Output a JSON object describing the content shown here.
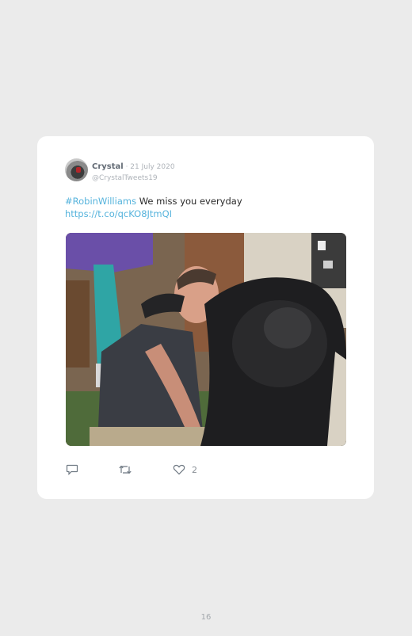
{
  "tweet": {
    "author_name": "Crystal",
    "separator": " · ",
    "date": "21 July 2020",
    "handle": "@CrystalTweets19",
    "hashtag": "#RobinWilliams",
    "text": " We miss you everyday",
    "link": "https://t.co/qcKO8JtmQI",
    "media_alt": "Robin Williams hugging Koko the gorilla",
    "actions": {
      "reply_icon": "reply-icon",
      "retweet_icon": "retweet-icon",
      "like_icon": "heart-icon",
      "like_count": "2"
    }
  },
  "footer": {
    "page_number": "16"
  },
  "colors": {
    "background": "#ebebeb",
    "card": "#ffffff",
    "link": "#55b3dc",
    "name": "#636b75",
    "muted": "#aeb3b9"
  }
}
